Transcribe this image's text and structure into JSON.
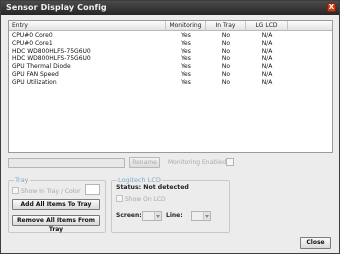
{
  "window": {
    "title": "Sensor Display Config",
    "close_glyph": "X"
  },
  "list": {
    "columns": [
      "Entry",
      "Monitoring",
      "In Tray",
      "LG LCD"
    ],
    "rows": [
      [
        "CPU#0 Core0",
        "Yes",
        "No",
        "N/A"
      ],
      [
        "CPU#0 Core1",
        "Yes",
        "No",
        "N/A"
      ],
      [
        "HDC WD800HLFS-75G6U0",
        "Yes",
        "No",
        "N/A"
      ],
      [
        "HDC WD800HLFS-75G6U0",
        "Yes",
        "No",
        "N/A"
      ],
      [
        "GPU Thermal Diode",
        "Yes",
        "No",
        "N/A"
      ],
      [
        "GPU FAN Speed",
        "Yes",
        "No",
        "N/A"
      ],
      [
        "GPU Utilization",
        "Yes",
        "No",
        "N/A"
      ]
    ]
  },
  "rename": {
    "input_value": "",
    "button_label": "Rename",
    "monitoring_label": "Monitoring Enabled"
  },
  "tray": {
    "title": "Tray",
    "show_label": "Show In Tray / Color",
    "add_label": "Add All Items To Tray",
    "remove_label": "Remove All Items From Tray"
  },
  "lcd": {
    "title": "Logitech LCD",
    "status": "Status: Not detected",
    "show_label": "Show On LCD",
    "screen_label": "Screen:",
    "line_label": "Line:"
  },
  "footer": {
    "close_label": "Close"
  },
  "colors": {
    "accent_title": "#7ea7c8",
    "close_red": "#c73b16"
  }
}
